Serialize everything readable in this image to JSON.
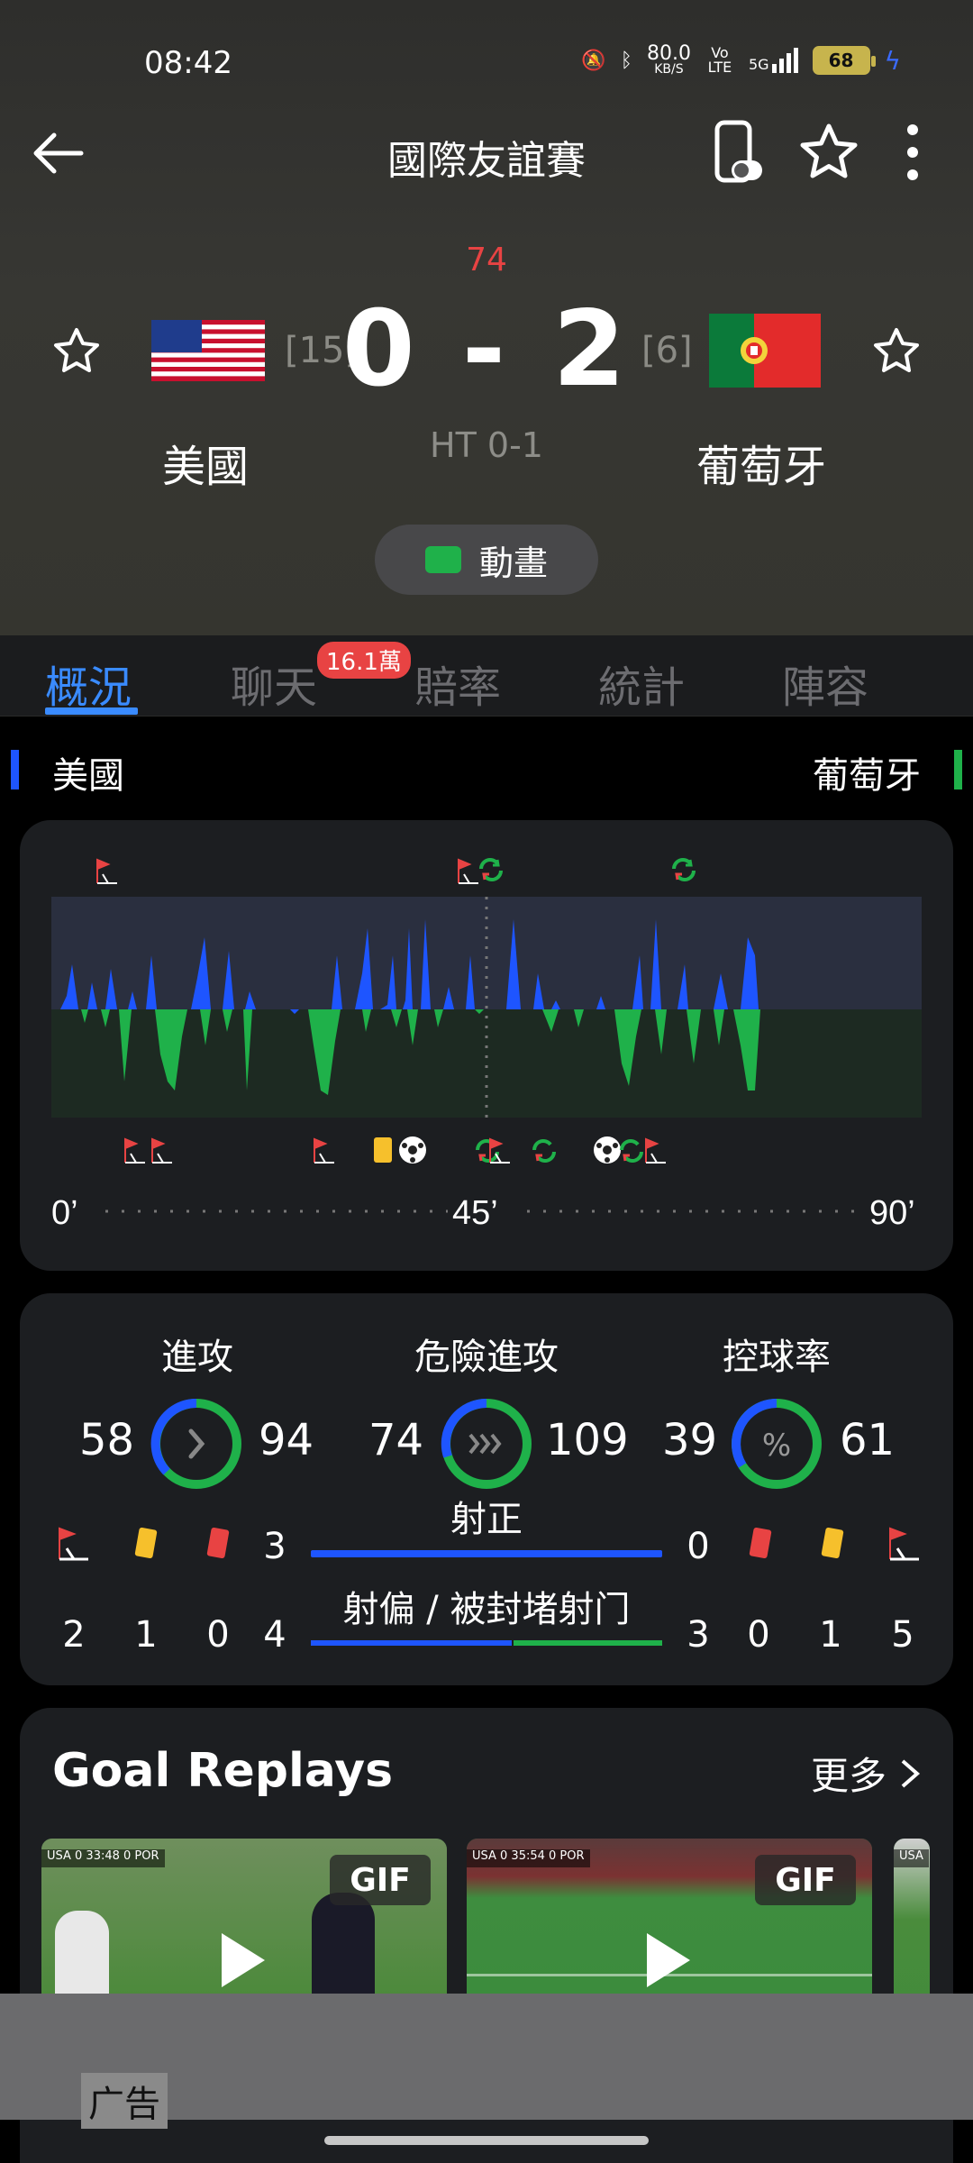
{
  "status_bar": {
    "time": "08:42",
    "net_speed": "80.0",
    "net_unit": "KB/S",
    "volte": "Vo LTE",
    "signal": "5G",
    "battery": "68"
  },
  "appbar": {
    "title": "國際友誼賽"
  },
  "match": {
    "minute": "74",
    "home": {
      "name": "美國",
      "rank": "[15]"
    },
    "away": {
      "name": "葡萄牙",
      "rank": "[6]"
    },
    "score": "0 - 2",
    "halftime": "HT 0-1",
    "animation_label": "動畫"
  },
  "tabs": [
    {
      "label": "概況",
      "active": true
    },
    {
      "label": "聊天",
      "badge": "16.1萬"
    },
    {
      "label": "賠率"
    },
    {
      "label": "統計"
    },
    {
      "label": "陣容"
    }
  ],
  "teams_row": {
    "home": "美國",
    "away": "葡萄牙",
    "home_color": "#1e55ff",
    "away_color": "#1fb14a"
  },
  "timeline": {
    "start": "0’",
    "mid": "45’",
    "end": "90’"
  },
  "stats": {
    "attack": {
      "label": "進攻",
      "home": "58",
      "away": "94"
    },
    "dangerous": {
      "label": "危險進攻",
      "home": "74",
      "away": "109"
    },
    "possession": {
      "label": "控球率",
      "home": "39",
      "away": "61",
      "icon_text": "%"
    },
    "on_target": {
      "label": "射正",
      "home": "3",
      "away": "0"
    },
    "off_target": {
      "label": "射偏 / 被封堵射门",
      "home": "4",
      "away": "3"
    },
    "home_corners": "2",
    "home_yellow": "1",
    "home_red": "0",
    "away_red": "0",
    "away_yellow": "1",
    "away_corners": "5"
  },
  "goal_replays": {
    "title": "Goal Replays",
    "more": "更多",
    "items": [
      {
        "scorebar": "USA 0  33:48  0 POR",
        "badge": "GIF"
      },
      {
        "scorebar": "USA 0  35:54  0 POR",
        "badge": "GIF"
      },
      {
        "scorebar": "USA",
        "badge": ""
      }
    ]
  },
  "ad": {
    "label": "广告"
  }
}
